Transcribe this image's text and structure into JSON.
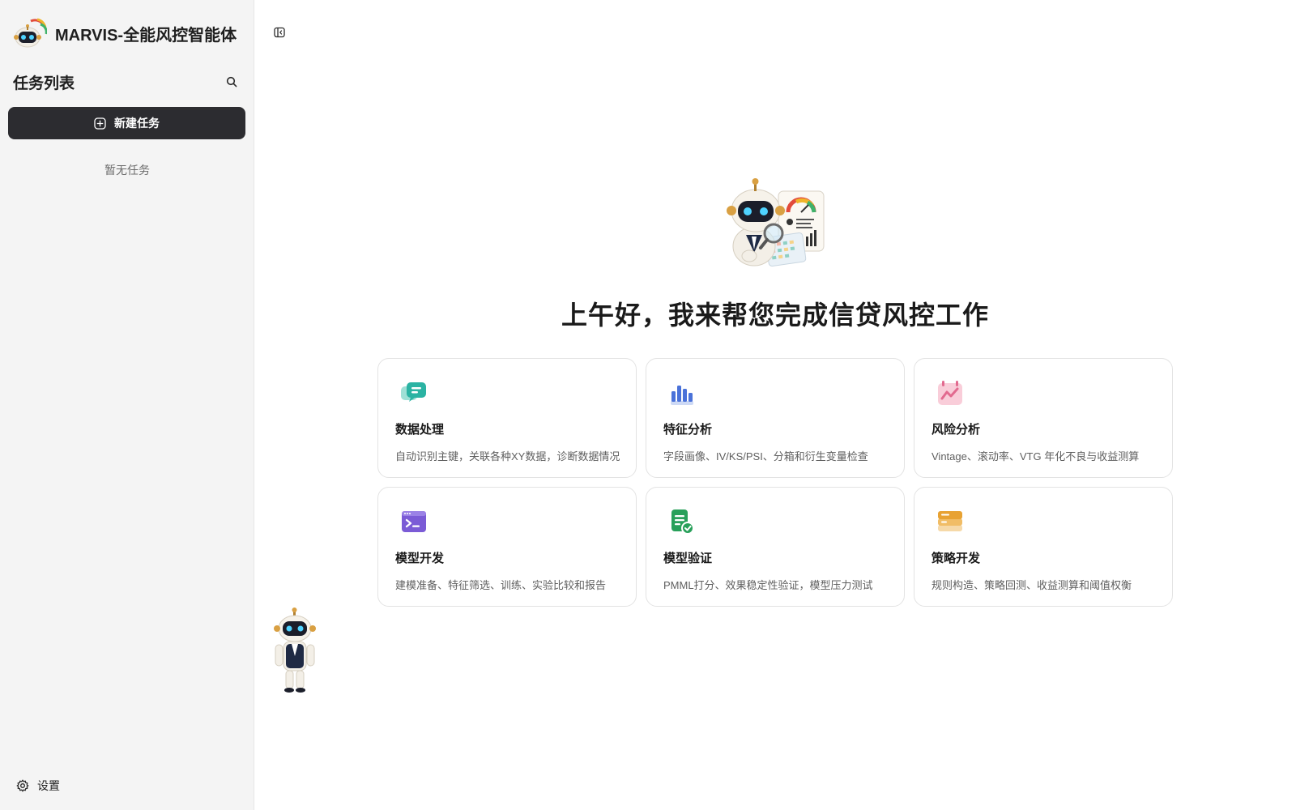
{
  "app": {
    "title": "MARVIS-全能风控智能体"
  },
  "sidebar": {
    "tasks_title": "任务列表",
    "new_task_label": "新建任务",
    "empty_text": "暂无任务",
    "settings_label": "设置"
  },
  "main": {
    "greeting": "上午好，我来帮您完成信贷风控工作",
    "cards": [
      {
        "title": "数据处理",
        "desc": "自动识别主键，关联各种XY数据，诊断数据情况",
        "icon": "chat-bubbles-icon",
        "color": "#2bb3a3"
      },
      {
        "title": "特征分析",
        "desc": "字段画像、IV/KS/PSI、分箱和衍生变量检查",
        "icon": "bar-chart-icon",
        "color": "#4a72d9"
      },
      {
        "title": "风险分析",
        "desc": "Vintage、滚动率、VTG 年化不良与收益测算",
        "icon": "calendar-trend-icon",
        "color": "#e26a8f"
      },
      {
        "title": "模型开发",
        "desc": "建模准备、特征筛选、训练、实验比较和报告",
        "icon": "terminal-window-icon",
        "color": "#7b5bd6"
      },
      {
        "title": "模型验证",
        "desc": "PMML打分、效果稳定性验证，模型压力测试",
        "icon": "document-check-icon",
        "color": "#28a05a"
      },
      {
        "title": "策略开发",
        "desc": "规则构造、策略回测、收益测算和阈值权衡",
        "icon": "stacked-layers-icon",
        "color": "#e8a233"
      }
    ]
  }
}
